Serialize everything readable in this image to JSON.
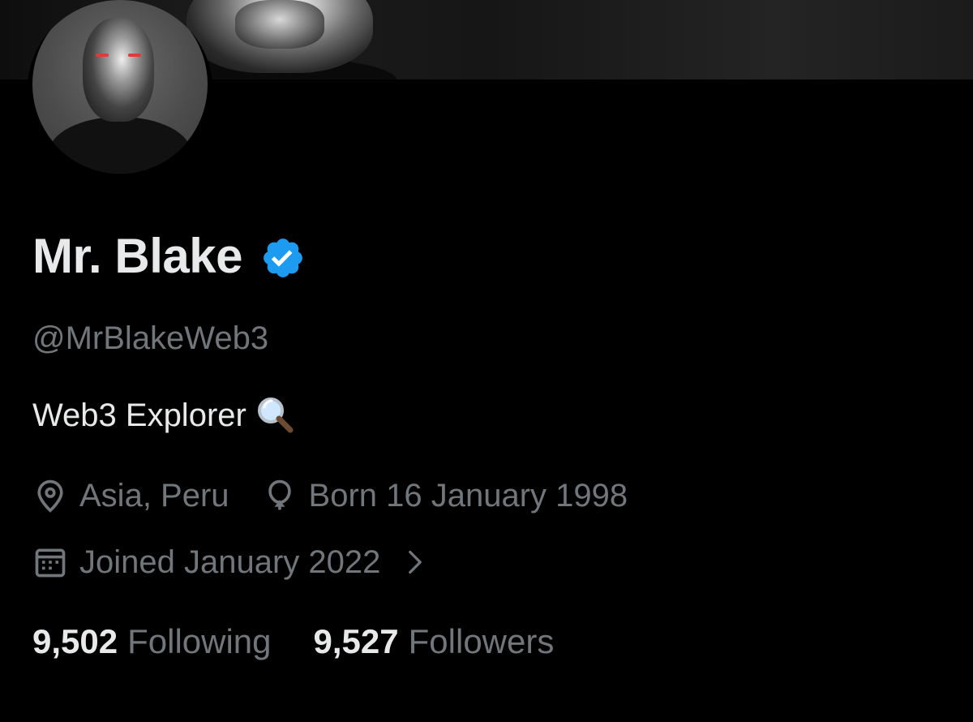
{
  "profile": {
    "display_name": "Mr. Blake",
    "verified": true,
    "verified_color": "#1d9bf0",
    "handle": "@MrBlakeWeb3",
    "bio": "Web3 Explorer",
    "bio_emoji": "magnifying-glass-emoji",
    "location": "Asia, Peru",
    "birthday": "Born 16 January 1998",
    "joined": "Joined January 2022",
    "following_count": "9,502",
    "following_label": "Following",
    "followers_count": "9,527",
    "followers_label": "Followers"
  },
  "icons": {
    "location": "location-pin-icon",
    "birthday": "balloon-icon",
    "joined": "calendar-icon",
    "verified": "verified-badge-icon",
    "chevron": "chevron-right-icon"
  },
  "colors": {
    "background": "#000000",
    "primary_text": "#e7e9ea",
    "secondary_text": "#71767b",
    "accent": "#1d9bf0"
  }
}
